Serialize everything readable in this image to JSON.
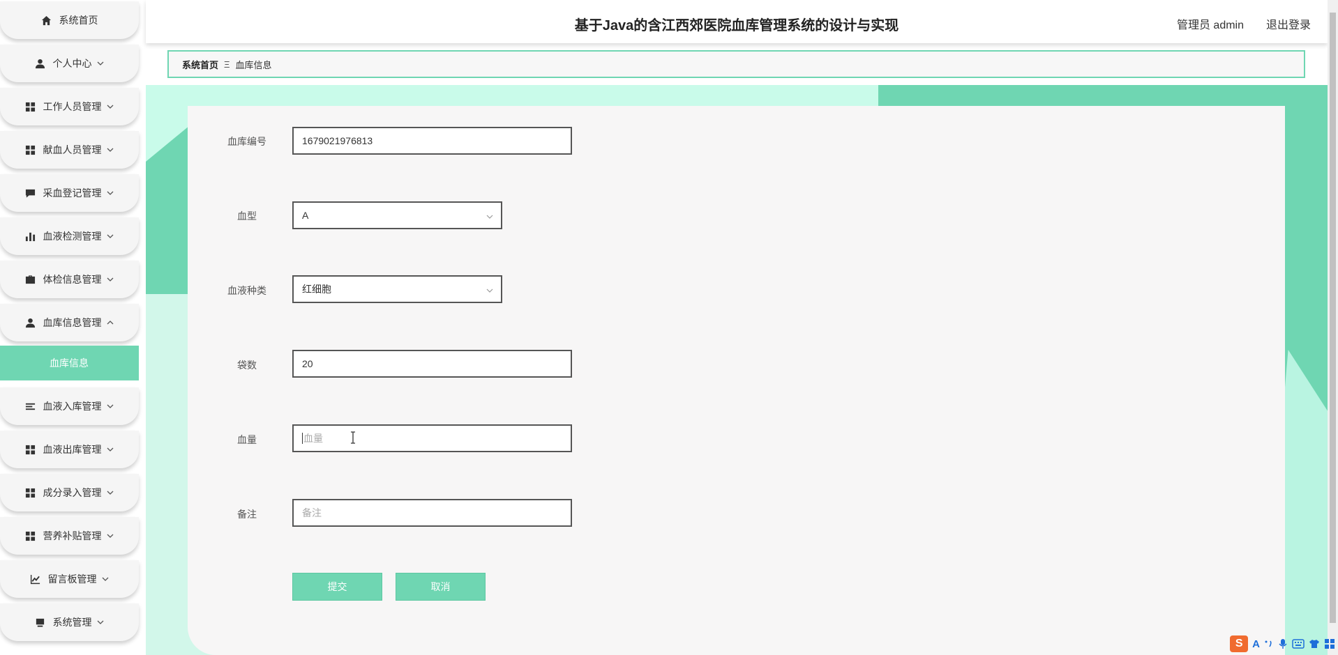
{
  "header": {
    "title": "基于Java的含江西郊医院血库管理系统的设计与实现",
    "user": "管理员 admin",
    "logout": "退出登录"
  },
  "sidebar": {
    "items": [
      {
        "label": "系统首页",
        "icon": "home-icon",
        "arrow": false
      },
      {
        "label": "个人中心",
        "icon": "user-icon",
        "arrow": "down"
      },
      {
        "label": "工作人员管理",
        "icon": "grid-icon",
        "arrow": "down"
      },
      {
        "label": "献血人员管理",
        "icon": "grid-icon",
        "arrow": "down"
      },
      {
        "label": "采血登记管理",
        "icon": "message-icon",
        "arrow": "down"
      },
      {
        "label": "血液检测管理",
        "icon": "bar-chart-icon",
        "arrow": "down"
      },
      {
        "label": "体检信息管理",
        "icon": "briefcase-icon",
        "arrow": "down"
      },
      {
        "label": "血库信息管理",
        "icon": "user-icon",
        "arrow": "up"
      },
      {
        "label": "血液入库管理",
        "icon": "list-icon",
        "arrow": "down"
      },
      {
        "label": "血液出库管理",
        "icon": "grid-icon",
        "arrow": "down"
      },
      {
        "label": "成分录入管理",
        "icon": "grid-icon",
        "arrow": "down"
      },
      {
        "label": "营养补贴管理",
        "icon": "grid-icon",
        "arrow": "down"
      },
      {
        "label": "留言板管理",
        "icon": "trend-icon",
        "arrow": "down"
      },
      {
        "label": "系统管理",
        "icon": "monitor-icon",
        "arrow": "down"
      }
    ],
    "active_sub": "血库信息"
  },
  "breadcrumb": {
    "home": "系统首页",
    "separator": "Ξ",
    "current": "血库信息"
  },
  "form": {
    "bank_no": {
      "label": "血库编号",
      "value": "1679021976813"
    },
    "blood_type": {
      "label": "血型",
      "value": "A"
    },
    "blood_kind": {
      "label": "血液种类",
      "value": "红细胞"
    },
    "bags": {
      "label": "袋数",
      "value": "20"
    },
    "volume": {
      "label": "血量",
      "placeholder": "血量"
    },
    "remark": {
      "label": "备注",
      "placeholder": "备注"
    },
    "submit": "提交",
    "cancel": "取消"
  },
  "ime": {
    "logo": "S",
    "lang": "A"
  },
  "colors": {
    "accent": "#6fd6b2",
    "accent_light": "#c9fbea",
    "panel": "#f7f6f6"
  }
}
